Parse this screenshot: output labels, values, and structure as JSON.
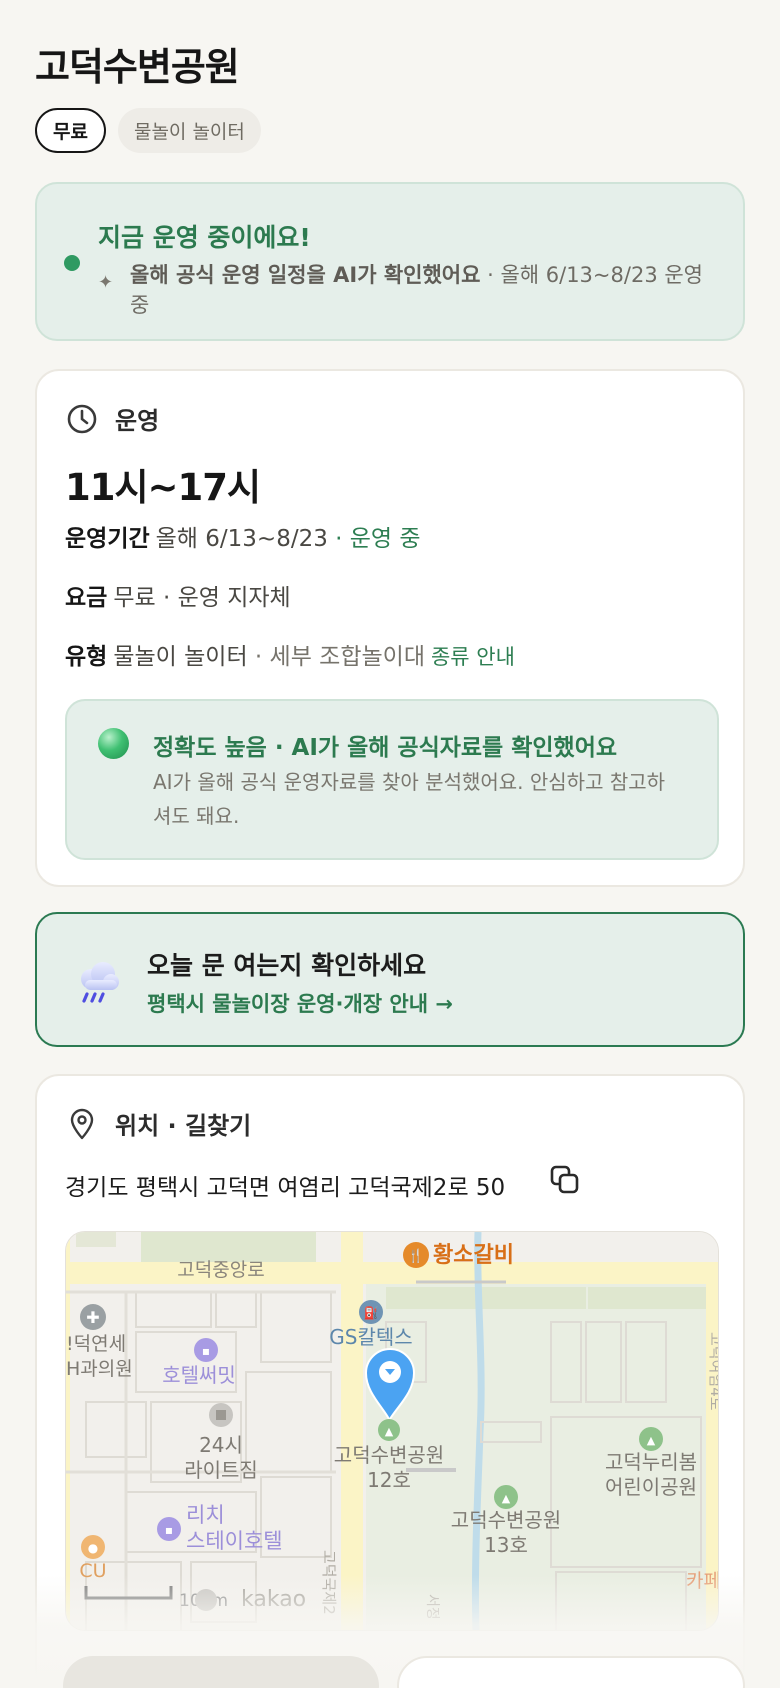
{
  "title": "고덕수변공원",
  "chips": [
    "무료",
    "물놀이 놀이터"
  ],
  "status": {
    "title": "지금 운영 중이에요!",
    "ai_note": "올해 공식 운영 일정을 AI가 확인했어요",
    "period": " · 올해 6/13~8/23 운영 중"
  },
  "operation": {
    "header": "운영",
    "hours": "11시~17시",
    "period_key": "운영기간",
    "period_value": "올해 6/13~8/23",
    "period_status": " · 운영 중",
    "fee_key": "요금",
    "fee_value": "무료 · 운영 지자체",
    "type_key": "유형",
    "type_value": "물놀이 놀이터",
    "type_detail": " · 세부 조합놀이대",
    "type_link": "종류 안내",
    "accuracy_title": "정확도 높음 · AI가 올해 공식자료를 확인했어요",
    "accuracy_desc": "AI가 올해 공식 운영자료를 찾아 분석했어요. 안심하고 참고하셔도 돼요."
  },
  "cta": {
    "title": "오늘 문 여는지 확인하세요",
    "link": "평택시 물놀이장 운영·개장 안내 →",
    "icon": "rain-cloud-icon"
  },
  "location": {
    "header": "위치 · 길찾기",
    "address": "경기도 평택시 고덕면 여염리 고덕국제2로 50",
    "map_labels": {
      "road_top": "고덕중앙로",
      "restaurant": "황소갈비",
      "clinic_1": "!덕연세",
      "clinic_2": "H과의원",
      "hotel": "호텔써밋",
      "gas_station": "GS칼텍스",
      "gym_1": "24시",
      "gym_2": "라이트짐",
      "park_12_1": "고덕수변공원",
      "park_12_2": "12호",
      "park_13_1": "고덕수변공원",
      "park_13_2": "13호",
      "kids_park_1": "고덕누리봄",
      "kids_park_2": "어린이공원",
      "stay_1": "리치",
      "stay_2": "스테이호텔",
      "cu": "CU",
      "scale": "100m",
      "brand": "kakao",
      "cafe": "카페",
      "road_right": "고덕여염4로",
      "road_bottom": "고덕국제2",
      "road_bottom2": "서정"
    }
  },
  "colors": {
    "accent_green": "#2c7a4f",
    "status_bg": "#e5efea",
    "pin_blue": "#4ba3f2"
  }
}
